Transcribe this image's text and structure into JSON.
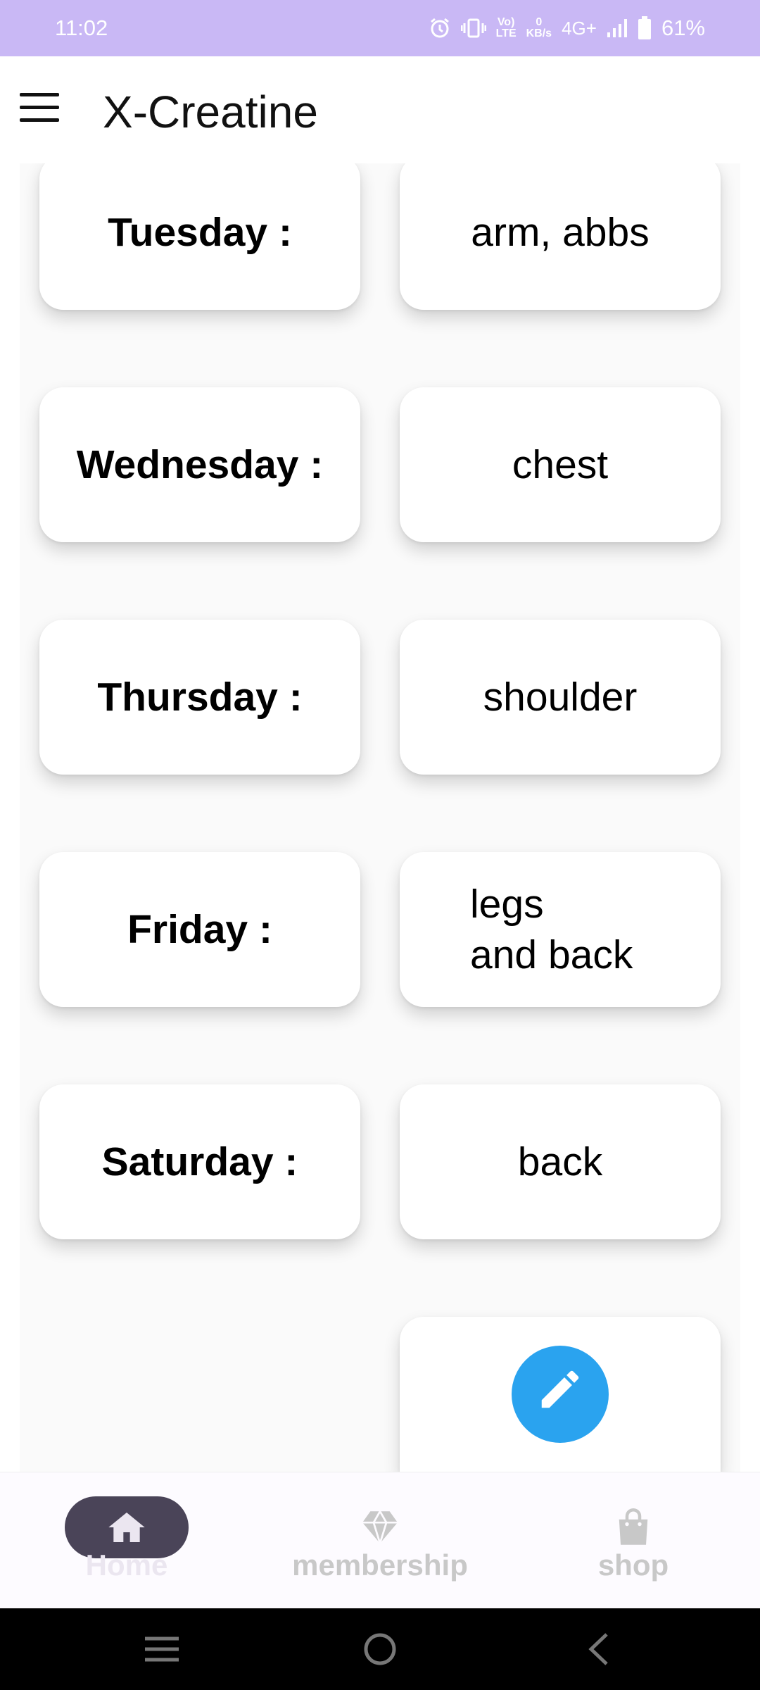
{
  "status_bar": {
    "time": "11:02",
    "network_speed_value": "0",
    "network_speed_unit": "KB/s",
    "volte_top": "Vo)",
    "volte_bottom": "LTE",
    "network_type": "4G+",
    "battery": "61%",
    "icons": [
      "alarm-icon",
      "vibrate-icon",
      "volte-icon",
      "signal-icon",
      "battery-icon"
    ]
  },
  "app_bar": {
    "title": "X-Creatine",
    "menu_icon": "hamburger-menu-icon"
  },
  "schedule": [
    {
      "day": "Tuesday :",
      "activity": "arm, abbs"
    },
    {
      "day": "Wednesday :",
      "activity": "chest"
    },
    {
      "day": "Thursday :",
      "activity": "shoulder"
    },
    {
      "day": "Friday :",
      "activity": "legs\nand back"
    },
    {
      "day": "Saturday :",
      "activity": "back"
    }
  ],
  "edit_button": {
    "icon": "pencil-icon",
    "color": "#2aa3ef"
  },
  "bottom_nav": {
    "items": [
      {
        "label": "Home",
        "icon": "home-icon",
        "selected": true
      },
      {
        "label": "membership",
        "icon": "diamond-icon",
        "selected": false
      },
      {
        "label": "shop",
        "icon": "shopping-bag-icon",
        "selected": false
      }
    ]
  },
  "system_nav": {
    "icons": [
      "recents-icon",
      "home-circle-icon",
      "back-icon"
    ]
  },
  "colors": {
    "status_bar": "#c9b8f5",
    "fab": "#2aa3ef",
    "nav_pill": "#4a4458"
  }
}
